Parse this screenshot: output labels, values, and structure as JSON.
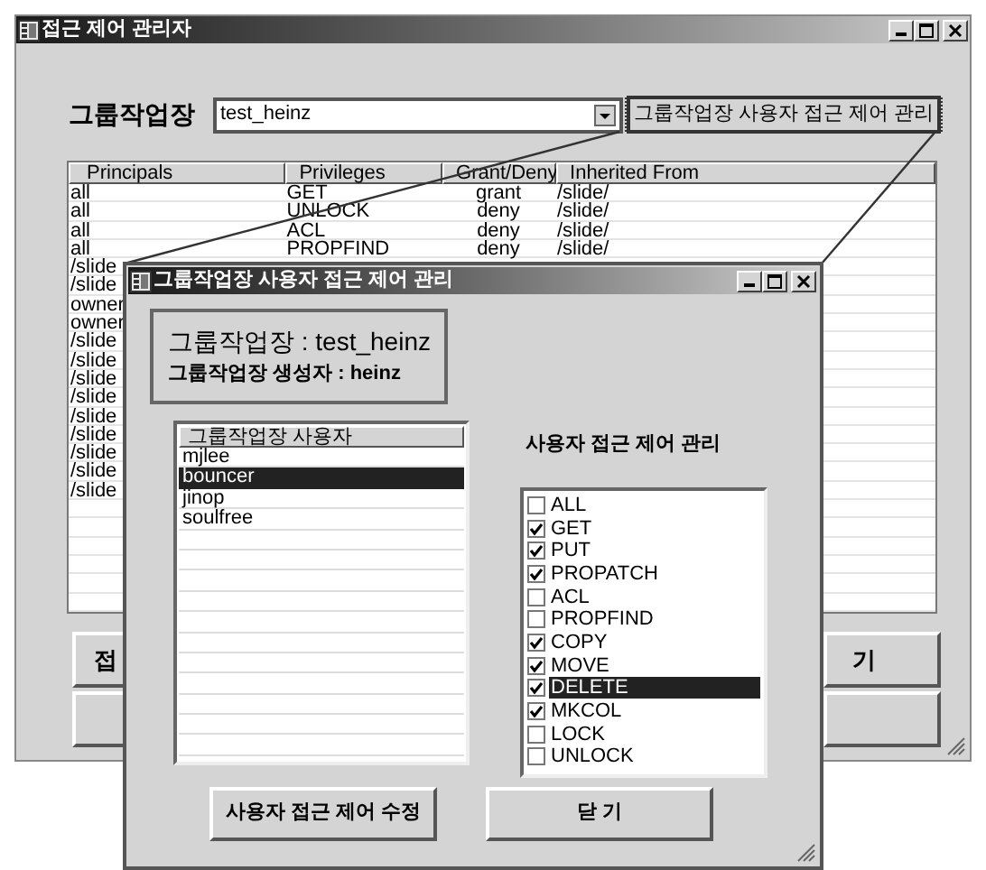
{
  "main_window": {
    "title": "접근 제어 관리자",
    "workspace_label": "그룹작업장",
    "workspace_combo": {
      "value": "test_heinz"
    },
    "manage_button": "그룹작업장 사용자 접근 제어 관리",
    "table": {
      "columns": [
        "Principals",
        "Privileges",
        "Grant/Deny",
        "Inherited From"
      ],
      "rows": [
        {
          "cells": [
            "all",
            "GET",
            "grant",
            "/slide/"
          ]
        },
        {
          "cells": [
            "all",
            "UNLOCK",
            "deny",
            "/slide/"
          ]
        },
        {
          "cells": [
            "all",
            "ACL",
            "deny",
            "/slide/"
          ]
        },
        {
          "cells": [
            "all",
            "PROPFIND",
            "deny",
            "/slide/"
          ]
        },
        {
          "cells": [
            "/slide"
          ]
        },
        {
          "cells": [
            "/slide"
          ]
        },
        {
          "cells": [
            "owner"
          ]
        },
        {
          "cells": [
            "owner"
          ]
        },
        {
          "cells": [
            "/slide"
          ]
        },
        {
          "cells": [
            "/slide"
          ]
        },
        {
          "cells": [
            "/slide"
          ]
        },
        {
          "cells": [
            "/slide"
          ]
        },
        {
          "cells": [
            "/slide"
          ]
        },
        {
          "cells": [
            "/slide"
          ]
        },
        {
          "cells": [
            "/slide"
          ]
        },
        {
          "cells": [
            "/slide"
          ]
        },
        {
          "cells": [
            "/slide"
          ]
        }
      ]
    },
    "buttons": [
      "접",
      "기"
    ]
  },
  "dialog": {
    "title": "그룹작업장 사용자 접근 제어 관리",
    "workspace_info": "그룹작업장 : test_heinz",
    "creator_info": "그룹작업장 생성자 : heinz",
    "users_list": {
      "header": "그룹작업장 사용자",
      "items": [
        {
          "name": "mjlee",
          "selected": false
        },
        {
          "name": "bouncer",
          "selected": true
        },
        {
          "name": "jinop",
          "selected": false
        },
        {
          "name": "soulfree",
          "selected": false
        }
      ]
    },
    "privileges_label": "사용자 접근 제어 관리",
    "privileges": [
      {
        "name": "ALL",
        "checked": false,
        "selected": false
      },
      {
        "name": "GET",
        "checked": true,
        "selected": false
      },
      {
        "name": "PUT",
        "checked": true,
        "selected": false
      },
      {
        "name": "PROPATCH",
        "checked": true,
        "selected": false
      },
      {
        "name": "ACL",
        "checked": false,
        "selected": false
      },
      {
        "name": "PROPFIND",
        "checked": false,
        "selected": false
      },
      {
        "name": "COPY",
        "checked": true,
        "selected": false
      },
      {
        "name": "MOVE",
        "checked": true,
        "selected": false
      },
      {
        "name": "DELETE",
        "checked": true,
        "selected": true
      },
      {
        "name": "MKCOL",
        "checked": true,
        "selected": false
      },
      {
        "name": "LOCK",
        "checked": false,
        "selected": false
      },
      {
        "name": "UNLOCK",
        "checked": false,
        "selected": false
      }
    ],
    "buttons": [
      "사용자 접근 제어 수정",
      "닫 기"
    ]
  }
}
